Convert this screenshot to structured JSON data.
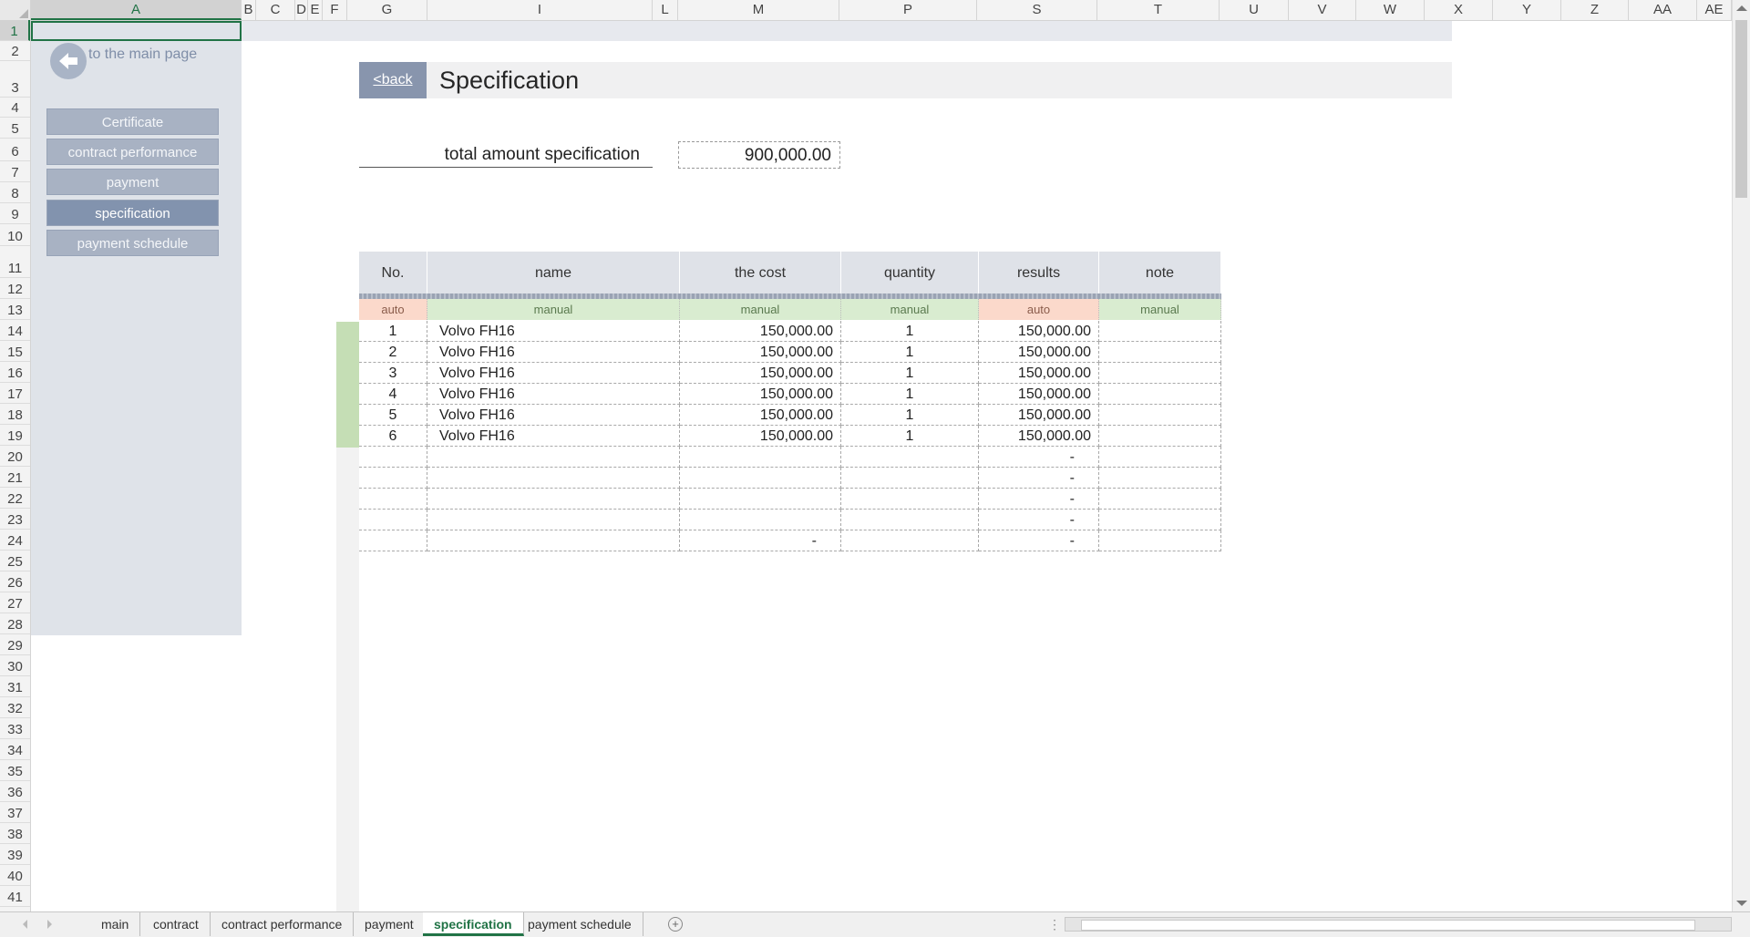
{
  "columns": [
    "A",
    "B",
    "C",
    "D",
    "E",
    "F",
    "G",
    "I",
    "L",
    "M",
    "P",
    "S",
    "T",
    "U",
    "V",
    "W",
    "X",
    "Y",
    "Z",
    "AA",
    "AE"
  ],
  "rows": [
    "1",
    "2",
    "3",
    "4",
    "5",
    "6",
    "7",
    "8",
    "9",
    "10",
    "11",
    "12",
    "13",
    "14",
    "15",
    "16",
    "17",
    "18",
    "19",
    "20",
    "21",
    "22",
    "23",
    "24",
    "25",
    "26",
    "27",
    "28",
    "29",
    "30",
    "31",
    "32",
    "33",
    "34",
    "35",
    "36",
    "37",
    "38",
    "39",
    "40",
    "41"
  ],
  "sidebar": {
    "main_link": "to the main page",
    "nav": [
      {
        "label": "Certificate",
        "active": false
      },
      {
        "label": "contract performance",
        "active": false
      },
      {
        "label": "payment",
        "active": false
      },
      {
        "label": "specification",
        "active": true
      },
      {
        "label": "payment schedule",
        "active": false
      }
    ]
  },
  "header": {
    "back_label": "<back",
    "title": "Specification"
  },
  "total": {
    "label": "total amount specification",
    "value": "900,000.00"
  },
  "table": {
    "headers": [
      "No.",
      "name",
      "the cost",
      "quantity",
      "results",
      "note"
    ],
    "tags": [
      "auto",
      "manual",
      "manual",
      "manual",
      "auto",
      "manual"
    ],
    "rows": [
      [
        "1",
        "Volvo FH16",
        "150,000.00",
        "1",
        "150,000.00",
        ""
      ],
      [
        "2",
        "Volvo FH16",
        "150,000.00",
        "1",
        "150,000.00",
        ""
      ],
      [
        "3",
        "Volvo FH16",
        "150,000.00",
        "1",
        "150,000.00",
        ""
      ],
      [
        "4",
        "Volvo FH16",
        "150,000.00",
        "1",
        "150,000.00",
        ""
      ],
      [
        "5",
        "Volvo FH16",
        "150,000.00",
        "1",
        "150,000.00",
        ""
      ],
      [
        "6",
        "Volvo FH16",
        "150,000.00",
        "1",
        "150,000.00",
        ""
      ],
      [
        "",
        "",
        "",
        "",
        "-",
        ""
      ],
      [
        "",
        "",
        "",
        "",
        "-",
        ""
      ],
      [
        "",
        "",
        "",
        "",
        "-",
        ""
      ],
      [
        "",
        "",
        "",
        "",
        "-",
        ""
      ],
      [
        "",
        "",
        "-",
        "",
        "-",
        ""
      ]
    ]
  },
  "sheet_tabs": [
    {
      "label": "main",
      "active": false
    },
    {
      "label": "contract",
      "active": false
    },
    {
      "label": "contract performance",
      "active": false
    },
    {
      "label": "payment",
      "active": false
    },
    {
      "label": "specification",
      "active": true
    },
    {
      "label": "payment schedule",
      "active": false
    }
  ],
  "colors": {
    "excel_green": "#217346",
    "nav_button": "#a8b2c3",
    "nav_active": "#8293ae",
    "auto_tag": "#fbd9cb",
    "manual_tag": "#d9ecd0"
  }
}
